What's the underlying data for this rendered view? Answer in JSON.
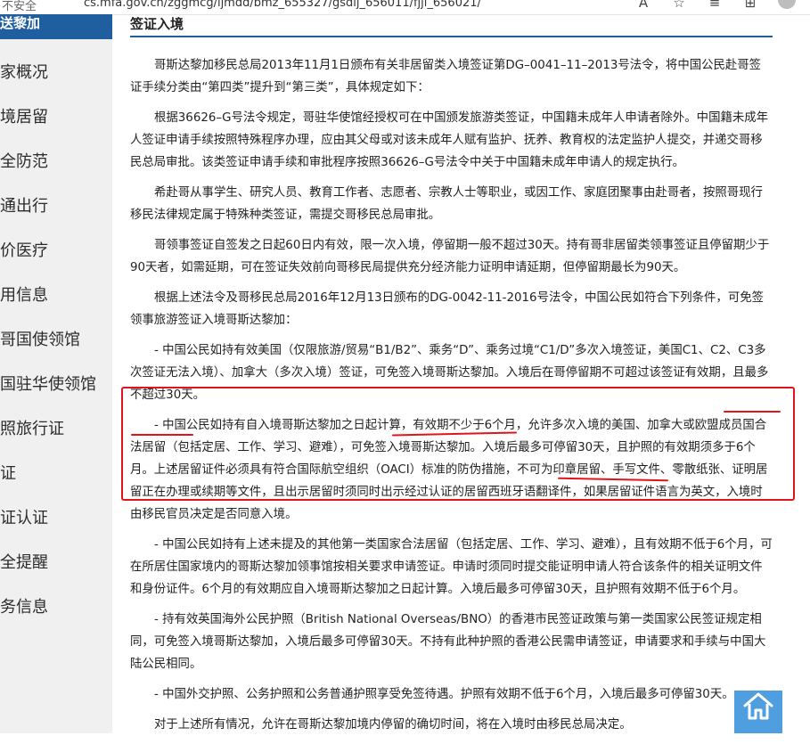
{
  "browser": {
    "security_label": "不安全",
    "url": "cs.mfa.gov.cn/zggmcg/ljmdd/bmz_655327/gsdlj_656011/fjjl_656021/",
    "icons": [
      "read-aloud-icon",
      "add-favorite-icon",
      "favorites-icon",
      "collections-icon",
      "profile-icon"
    ]
  },
  "sidebar": {
    "top_label": "送黎加",
    "items": [
      {
        "label": "家概况"
      },
      {
        "label": "境居留"
      },
      {
        "label": "全防范"
      },
      {
        "label": "通出行"
      },
      {
        "label": "价医疗"
      },
      {
        "label": "用信息"
      },
      {
        "label": "哥国使领馆"
      },
      {
        "label": "国驻华使领馆"
      },
      {
        "label": "照旅行证"
      },
      {
        "label": "证"
      },
      {
        "label": "证认证"
      },
      {
        "label": "全提醒"
      },
      {
        "label": "务信息"
      }
    ]
  },
  "main": {
    "section_title": "签证入境",
    "paragraphs": [
      {
        "text": "哥斯达黎加移民总局2013年11月1日颁布有关非居留类入境签证第DG–0041–11–2013号法令，将中国公民赴哥签证手续分类由“第四类”提升到“第三类”，具体规定如下："
      },
      {
        "text": "根据36626–G号法令规定，哥驻华使馆经授权可在中国颁发旅游类签证，中国籍未成年人申请者除外。中国籍未成年人签证申请手续按照特殊程序办理，应由其父母或对该未成年人赋有监护、抚养、教育权的法定监护人提交，并递交哥移民总局审批。该类签证申请手续和审批程序按照36626–G号法令中关于中国籍未成年申请人的规定执行。"
      },
      {
        "text": "希赴哥从事学生、研究人员、教育工作者、志愿者、宗教人士等职业，或因工作、家庭团聚事由赴哥者，按照哥现行移民法律规定属于特殊种类签证，需提交哥移民总局审批。"
      },
      {
        "text": "哥领事签证自签发之日起60日内有效，限一次入境，停留期一般不超过30天。持有哥非居留类领事签证且停留期少于90天者，如需延期，可在签证失效前向哥移民局提供充分经济能力证明申请延期，但停留期最长为90天。"
      },
      {
        "text": "根据上述法令及哥移民总局2016年12月13日颁布的DG-0042-11-2016号法令，中国公民如符合下列条件，可免签领事旅游签证入境哥斯达黎加："
      },
      {
        "text": "- 中国公民如持有效美国（仅限旅游/贸易“B1/B2”、乘务“D”、乘务过境“C1/D”多次入境签证，美国C1、C2、C3多次签证无法入境）、加拿大（多次入境）签证，可免签入境哥斯达黎加。入境后在哥停留期不可超过该签证有效期，且最多不超过30天。"
      },
      {
        "text": "- 中国公民如持有自入境哥斯达黎加之日起计算，有效期不少于6个月，允许多次入境的美国、加拿大或欧盟成员国合法居留（包括定居、工作、学习、避难），可免签入境哥斯达黎加。入境后最多可停留30天，且护照的有效期须多于6个月。上述居留证件必须具有符合国际航空组织（OACI）标准的防伪措施，不可为印章居留、手写文件、零散纸张、证明居留正在办理或续期等文件，且出示居留时须同时出示经过认证的居留西班牙语翻译件，如果居留证件语言为英文，入境时由移民官员决定是否同意入境。"
      },
      {
        "text": "- 中国公民如持有上述未提及的其他第一类国家合法居留（包括定居、工作、学习、避难），且有效期不低于6个月，可在所居住国家境内的哥斯达黎加领事馆按相关要求申请签证。申请时须同时提交能证明申请人符合该条件的相关证明文件和身份证件。6个月的有效期应自入境哥斯达黎加之日起计算。入境后最多可停留30天，且护照有效期不低于6个月。"
      },
      {
        "text": "- 持有效英国海外公民护照（British National Overseas/BNO）的香港市民签证政策与第一类国家公民签证规定相同，可免签入境哥斯达黎加，入境后最多可停留30天。不持有此种护照的香港公民需申请签证，申请要求和手续与中国大陆公民相同。"
      },
      {
        "text": "- 中国外交护照、公务护照和公务普通护照享受免签待遇。护照有效期不低于6个月，入境后最多可停留30天。"
      },
      {
        "text": "对于上述所有情况，允许在哥斯达黎加境内停留的确切时间，将在入境时由移民总局决定。"
      }
    ]
  },
  "colors": {
    "accent": "#1f5fa0",
    "annotation": "#e0141c",
    "home_button": "#4f9fe0"
  }
}
